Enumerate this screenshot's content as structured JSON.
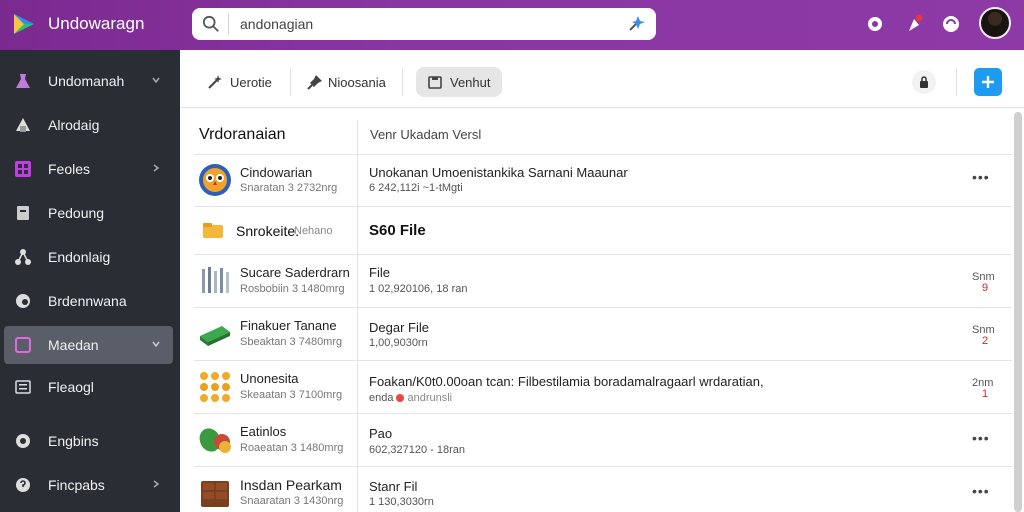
{
  "app": {
    "title": "Undowaragn"
  },
  "search": {
    "value": "andonagian"
  },
  "sidebar": {
    "items": [
      {
        "label": "Undomanah",
        "icon": "flask-icon",
        "chevron": true,
        "active": false
      },
      {
        "label": "Alrodaig",
        "icon": "shape-icon",
        "chevron": false,
        "active": false
      },
      {
        "label": "Feoles",
        "icon": "grid-icon",
        "chevron": true,
        "active": false
      },
      {
        "label": "Pedoung",
        "icon": "document-icon",
        "chevron": false,
        "active": false
      },
      {
        "label": "Endonlaig",
        "icon": "share-icon",
        "chevron": false,
        "active": false
      },
      {
        "label": "Brdennwana",
        "icon": "globe-icon",
        "chevron": false,
        "active": false
      },
      {
        "label": "Maedan",
        "icon": "tag-icon",
        "chevron": true,
        "active": true
      },
      {
        "label": "Fleaogl",
        "icon": "list-icon",
        "chevron": false,
        "active": false
      },
      {
        "label": "Engbins",
        "icon": "settings-icon",
        "chevron": false,
        "active": false
      },
      {
        "label": "Fincpabs",
        "icon": "help-icon",
        "chevron": true,
        "active": false
      }
    ]
  },
  "toolbar": {
    "btn1": "Uerotie",
    "btn2": "Nioosania",
    "btn3": "Venhut"
  },
  "table": {
    "header_name": "Vrdoranaian",
    "header_desc": "Venr Ukadam  Versl",
    "rows": [
      {
        "name": "Cindowarian",
        "meta": "Snaratan 3 2732nrg",
        "title": "Unokanan Umoenistankika Sarnani Maaunar",
        "sub": "6 242,112i ~1-tMgti",
        "more": "•••",
        "thumb": "owl"
      },
      {
        "name": "Sucare Saderdrarn",
        "meta": "Rosbobiin 3 1480mrg",
        "title": "File",
        "sub": "1 02,920106,  18 ran",
        "more": "Snm",
        "badge": "9",
        "thumb": "tools"
      },
      {
        "name": "Finakuer Tanane",
        "meta": "Sbeaktan 3 7480mrg",
        "title": "Degar File",
        "sub": "1,00,9030rn",
        "more": "Snm",
        "badge": "2",
        "thumb": "bar"
      },
      {
        "name": "Unonesita",
        "meta": "Skeaatan 3 7100mrg",
        "title": "Foakan/K0t0.00oan tcan:  Filbestilamia  boradamalragaarl  wrdaratian,",
        "sub": "enda",
        "sub2": "andrunsli",
        "more": "2nm",
        "badge": "1",
        "thumb": "dots"
      },
      {
        "name": "Eatinlos",
        "meta": "Roaeatan 3 1480mrg",
        "title": "Pao",
        "sub": "602,327120 - 18ran",
        "more": "•••",
        "thumb": "leaf"
      },
      {
        "name": "Insdan Pearkam",
        "meta": "Snaaratan 3 1430nrg",
        "title": "Stanr Fil",
        "sub": "1 130,3030rn",
        "more": "•••",
        "thumb": "chocolate"
      }
    ],
    "group": {
      "name": "Snrokeite.",
      "sub": "Nehano",
      "right": "S60 File"
    }
  },
  "colors": {
    "brand": "#8a36a2",
    "sidebar": "#2a2d33",
    "accent": "#1c9bf0",
    "alert": "#d02a2a"
  }
}
